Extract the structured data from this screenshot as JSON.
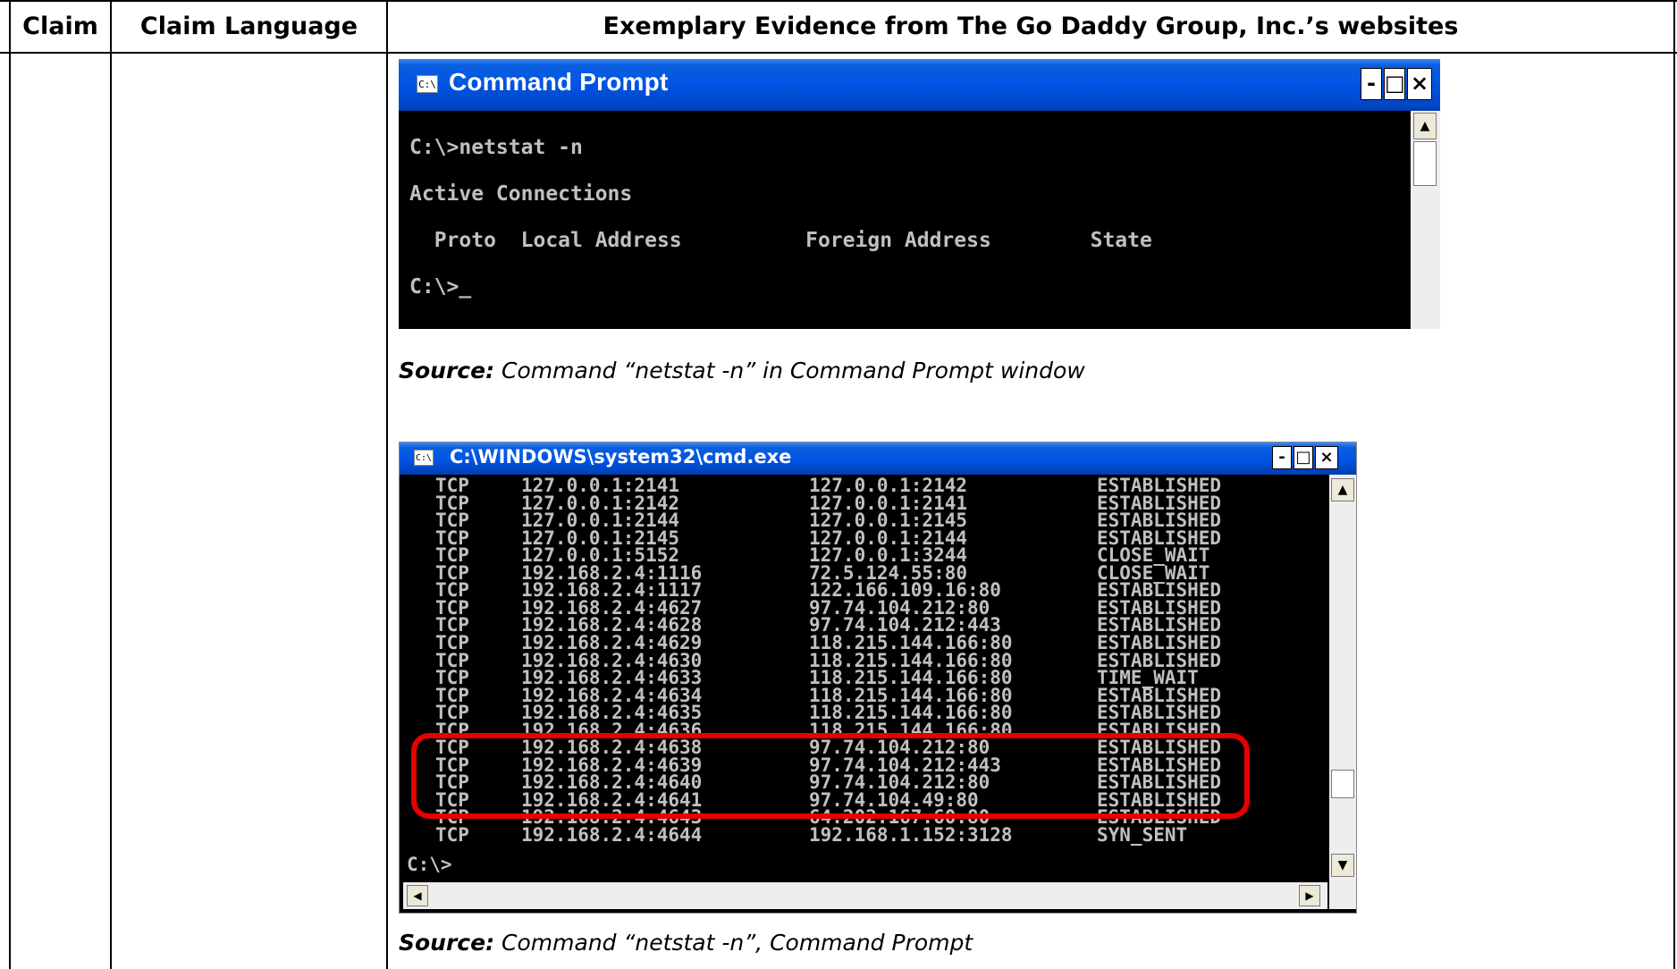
{
  "table": {
    "headers": [
      "Claim",
      "Claim Language",
      "Exemplary Evidence from The Go Daddy Group, Inc.’s websites"
    ]
  },
  "window1": {
    "icon": "C:\\",
    "title": "Command Prompt",
    "btn_min": "-",
    "btn_max": "□",
    "btn_close": "×",
    "lines": [
      "C:\\>netstat -n",
      "Active Connections",
      "  Proto  Local Address          Foreign Address        State",
      "C:\\>_"
    ]
  },
  "source1": {
    "prefix": "Source:",
    "text": " Command “netstat -n” in Command Prompt window"
  },
  "window2": {
    "icon": "C:\\",
    "title": "C:\\WINDOWS\\system32\\cmd.exe",
    "btn_min": "-",
    "btn_max": "□",
    "btn_close": "×",
    "rows": [
      [
        "TCP",
        "127.0.0.1:2141",
        "127.0.0.1:2142",
        "ESTABLISHED"
      ],
      [
        "TCP",
        "127.0.0.1:2142",
        "127.0.0.1:2141",
        "ESTABLISHED"
      ],
      [
        "TCP",
        "127.0.0.1:2144",
        "127.0.0.1:2145",
        "ESTABLISHED"
      ],
      [
        "TCP",
        "127.0.0.1:2145",
        "127.0.0.1:2144",
        "ESTABLISHED"
      ],
      [
        "TCP",
        "127.0.0.1:5152",
        "127.0.0.1:3244",
        "CLOSE_WAIT"
      ],
      [
        "TCP",
        "192.168.2.4:1116",
        "72.5.124.55:80",
        "CLOSE_WAIT"
      ],
      [
        "TCP",
        "192.168.2.4:1117",
        "122.166.109.16:80",
        "ESTABLISHED"
      ],
      [
        "TCP",
        "192.168.2.4:4627",
        "97.74.104.212:80",
        "ESTABLISHED"
      ],
      [
        "TCP",
        "192.168.2.4:4628",
        "97.74.104.212:443",
        "ESTABLISHED"
      ],
      [
        "TCP",
        "192.168.2.4:4629",
        "118.215.144.166:80",
        "ESTABLISHED"
      ],
      [
        "TCP",
        "192.168.2.4:4630",
        "118.215.144.166:80",
        "ESTABLISHED"
      ],
      [
        "TCP",
        "192.168.2.4:4633",
        "118.215.144.166:80",
        "TIME_WAIT"
      ],
      [
        "TCP",
        "192.168.2.4:4634",
        "118.215.144.166:80",
        "ESTABLISHED"
      ],
      [
        "TCP",
        "192.168.2.4:4635",
        "118.215.144.166:80",
        "ESTABLISHED"
      ],
      [
        "TCP",
        "192.168.2.4:4636",
        "118.215.144.166:80",
        "ESTABLISHED"
      ],
      [
        "TCP",
        "192.168.2.4:4638",
        "97.74.104.212:80",
        "ESTABLISHED"
      ],
      [
        "TCP",
        "192.168.2.4:4639",
        "97.74.104.212:443",
        "ESTABLISHED"
      ],
      [
        "TCP",
        "192.168.2.4:4640",
        "97.74.104.212:80",
        "ESTABLISHED"
      ],
      [
        "TCP",
        "192.168.2.4:4641",
        "97.74.104.49:80",
        "ESTABLISHED"
      ],
      [
        "TCP",
        "192.168.2.4:4643",
        "64.202.167.60:80",
        "ESTABLISHED"
      ],
      [
        "TCP",
        "192.168.2.4:4644",
        "192.168.1.152:3128",
        "SYN_SENT"
      ]
    ],
    "prompt": "C:\\>"
  },
  "source2": {
    "prefix": "Source:",
    "text": " Command “netstat -n”, Command Prompt"
  },
  "colors": {
    "xp_title": "#0054e3",
    "console_text": "#c0c0c0",
    "highlight": "#e60000"
  }
}
